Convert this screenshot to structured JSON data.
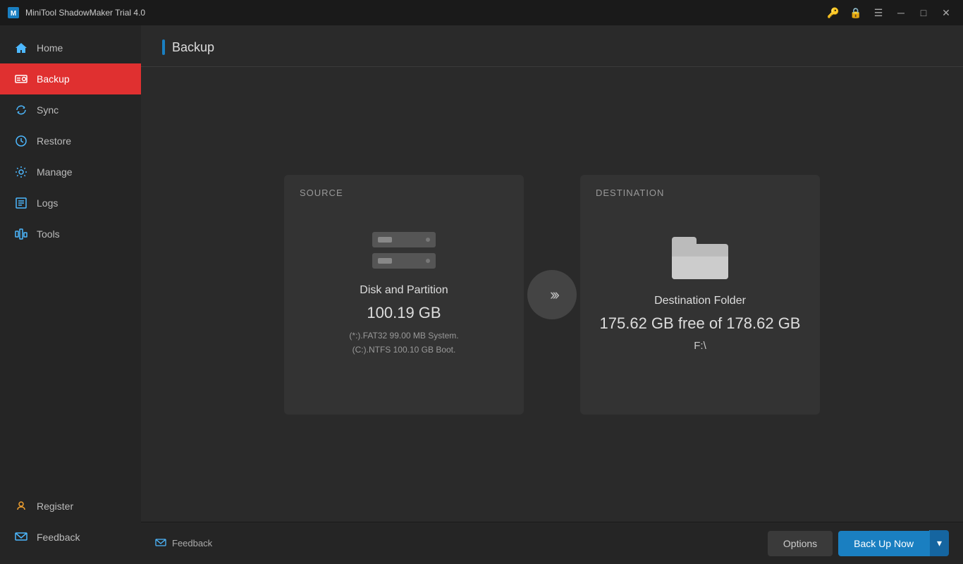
{
  "titlebar": {
    "title": "MiniTool ShadowMaker Trial 4.0",
    "controls": {
      "minimize": "─",
      "maximize": "□",
      "close": "✕"
    }
  },
  "sidebar": {
    "items": [
      {
        "id": "home",
        "label": "Home",
        "active": false
      },
      {
        "id": "backup",
        "label": "Backup",
        "active": true
      },
      {
        "id": "sync",
        "label": "Sync",
        "active": false
      },
      {
        "id": "restore",
        "label": "Restore",
        "active": false
      },
      {
        "id": "manage",
        "label": "Manage",
        "active": false
      },
      {
        "id": "logs",
        "label": "Logs",
        "active": false
      },
      {
        "id": "tools",
        "label": "Tools",
        "active": false
      }
    ],
    "bottom": [
      {
        "id": "register",
        "label": "Register"
      },
      {
        "id": "feedback",
        "label": "Feedback"
      }
    ]
  },
  "page": {
    "title": "Backup"
  },
  "source": {
    "label": "SOURCE",
    "name": "Disk and Partition",
    "size": "100.19 GB",
    "detail_line1": "(*:).FAT32 99.00 MB System.",
    "detail_line2": "(C:).NTFS 100.10 GB Boot."
  },
  "destination": {
    "label": "DESTINATION",
    "name": "Destination Folder",
    "free": "175.62 GB free of 178.62 GB",
    "path": "F:\\"
  },
  "footer": {
    "feedback_label": "Feedback",
    "options_label": "Options",
    "backup_label": "Back Up Now"
  }
}
